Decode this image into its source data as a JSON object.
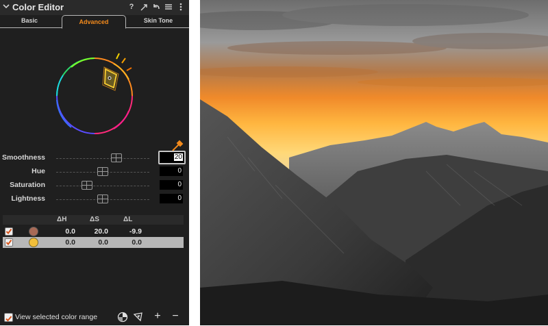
{
  "panel": {
    "title": "Color Editor",
    "title_icons": [
      "help-icon",
      "expand-icon",
      "reset-icon",
      "menu-icon",
      "more-icon"
    ],
    "help_glyph": "?",
    "tabs": [
      {
        "label": "Basic",
        "active": false
      },
      {
        "label": "Advanced",
        "active": true
      },
      {
        "label": "Skin Tone",
        "active": false
      }
    ]
  },
  "sliders": [
    {
      "label": "Smoothness",
      "value": "20",
      "level": 0.65,
      "focused": true
    },
    {
      "label": "Hue",
      "value": "0",
      "level": 0.5,
      "focused": false
    },
    {
      "label": "Saturation",
      "value": "0",
      "level": 0.33,
      "focused": false
    },
    {
      "label": "Lightness",
      "value": "0",
      "level": 0.5,
      "focused": false
    }
  ],
  "table": {
    "headers": [
      "ΔH",
      "ΔS",
      "ΔL"
    ],
    "rows": [
      {
        "checked": true,
        "swatch": "#a86a56",
        "dh": "0.0",
        "ds": "20.0",
        "dl": "-9.9",
        "selected": false
      },
      {
        "checked": true,
        "swatch": "#f2bf3a",
        "dh": "0.0",
        "ds": "0.0",
        "dl": "0.0",
        "selected": true
      }
    ]
  },
  "bottom": {
    "view_label": "View selected color range",
    "view_checked": true,
    "plus": "+",
    "minus": "−"
  },
  "colors": {
    "accent": "#f28a1c",
    "panel_bg": "#1f1f1f",
    "checkbox_mark": "#d9541a"
  }
}
